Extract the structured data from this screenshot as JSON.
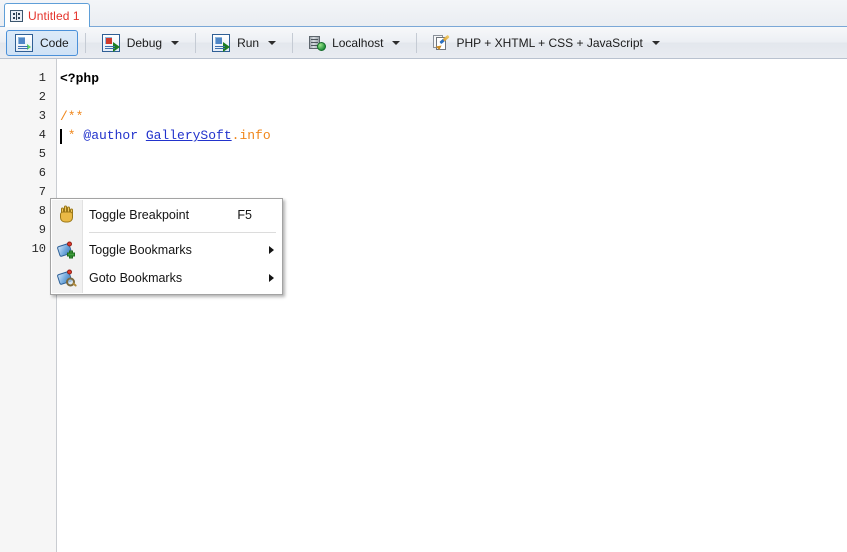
{
  "window": {
    "tab": {
      "icon": "code-window-icon",
      "title": "Untitled 1"
    }
  },
  "toolbar": {
    "buttons": [
      {
        "label": "Code",
        "icon": "code-page-icon",
        "has_dropdown": false,
        "active": true
      },
      {
        "label": "Debug",
        "icon": "debug-page-icon",
        "has_dropdown": true,
        "active": false
      },
      {
        "label": "Run",
        "icon": "run-page-icon",
        "has_dropdown": true,
        "active": false
      },
      {
        "label": "Localhost",
        "icon": "server-globe-icon",
        "has_dropdown": true,
        "active": false
      },
      {
        "label": "PHP + XHTML + CSS + JavaScript",
        "icon": "document-pen-icon",
        "has_dropdown": true,
        "active": false
      }
    ]
  },
  "editor": {
    "line_numbers": [
      "1",
      "2",
      "3",
      "4",
      "5",
      "6",
      "7",
      "8",
      "9",
      "10"
    ],
    "lines": [
      {
        "n": "1",
        "tokens": [
          {
            "text": "<?php",
            "cls": "tok-tag"
          }
        ]
      },
      {
        "n": "2",
        "tokens": []
      },
      {
        "n": "3",
        "tokens": [
          {
            "text": "/**",
            "cls": "tok-cmt"
          }
        ]
      },
      {
        "n": "4",
        "tokens": [
          {
            "text": " * ",
            "cls": "tok-cmt"
          },
          {
            "text": "@author",
            "cls": "tok-phpdoc"
          },
          {
            "text": " ",
            "cls": "tok-cmt"
          },
          {
            "text": "GallerySoft",
            "cls": "tok-link"
          },
          {
            "text": ".info",
            "cls": "tok-cmt"
          }
        ]
      },
      {
        "n": "5",
        "tokens": []
      },
      {
        "n": "6",
        "tokens": []
      },
      {
        "n": "7",
        "tokens": []
      },
      {
        "n": "8",
        "tokens": []
      },
      {
        "n": "9",
        "tokens": []
      },
      {
        "n": "10",
        "tokens": [
          {
            "text": "?>",
            "cls": "tok-tag"
          }
        ]
      }
    ]
  },
  "context_menu": {
    "items": [
      {
        "label": "Toggle Breakpoint",
        "accel": "F5",
        "icon": "hand-icon",
        "submenu": false
      },
      {
        "label": "Toggle Bookmarks",
        "accel": "",
        "icon": "bookmark-add-icon",
        "submenu": true
      },
      {
        "label": "Goto Bookmarks",
        "accel": "",
        "icon": "bookmark-search-icon",
        "submenu": true
      }
    ]
  },
  "colors": {
    "tab_text": "#e4322a",
    "comment": "#f0861a",
    "phpdoc_tag": "#2233cc",
    "accent_border": "#5f9fd8"
  }
}
